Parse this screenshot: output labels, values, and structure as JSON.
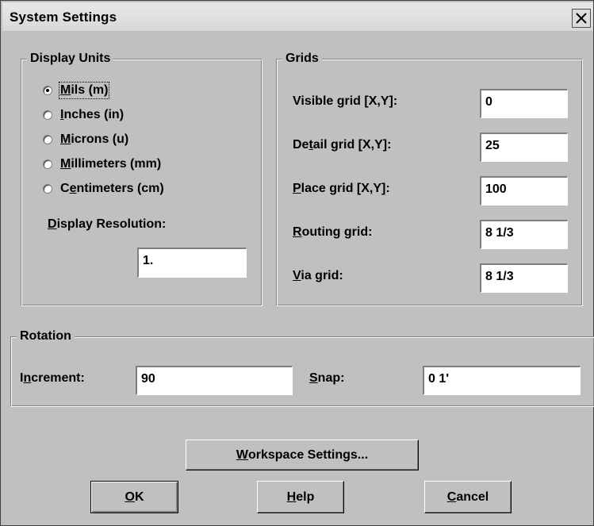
{
  "window": {
    "title": "System Settings",
    "close_icon": "close-icon"
  },
  "display_units": {
    "legend": "Display Units",
    "options": [
      {
        "pre": "",
        "key": "M",
        "post": "ils (m)",
        "checked": true
      },
      {
        "pre": "",
        "key": "I",
        "post": "nches (in)",
        "checked": false
      },
      {
        "pre": "",
        "key": "M",
        "post": "icrons (u)",
        "checked": false
      },
      {
        "pre": "",
        "key": "M",
        "post": "illimeters (mm)",
        "checked": false
      },
      {
        "pre": "C",
        "key": "e",
        "post": "ntimeters (cm)",
        "checked": false
      }
    ],
    "resolution_label_key": "D",
    "resolution_label_rest": "isplay Resolution:",
    "resolution_value": "1."
  },
  "grids": {
    "legend": "Grids",
    "visible": {
      "pre": "Visible grid [X,Y]:",
      "key": "",
      "post": "",
      "value": "0"
    },
    "detail": {
      "pre": "De",
      "key": "t",
      "post": "ail grid [X,Y]:",
      "value": "25"
    },
    "place": {
      "pre": "",
      "key": "P",
      "post": "lace grid [X,Y]:",
      "value": "100"
    },
    "routing": {
      "pre": "",
      "key": "R",
      "post": "outing grid:",
      "value": "8 1/3"
    },
    "via": {
      "pre": "",
      "key": "V",
      "post": "ia grid:",
      "value": "8 1/3"
    }
  },
  "rotation": {
    "legend": "Rotation",
    "increment": {
      "pre": "I",
      "key": "n",
      "post": "crement:",
      "value": "90"
    },
    "snap": {
      "pre": "",
      "key": "S",
      "post": "nap:",
      "value": "0 1'"
    }
  },
  "buttons": {
    "workspace": {
      "key": "W",
      "rest": "orkspace Settings..."
    },
    "ok": {
      "key": "O",
      "rest": "K"
    },
    "help": {
      "key": "H",
      "rest": "elp"
    },
    "cancel": {
      "key": "C",
      "rest": "ancel"
    }
  }
}
